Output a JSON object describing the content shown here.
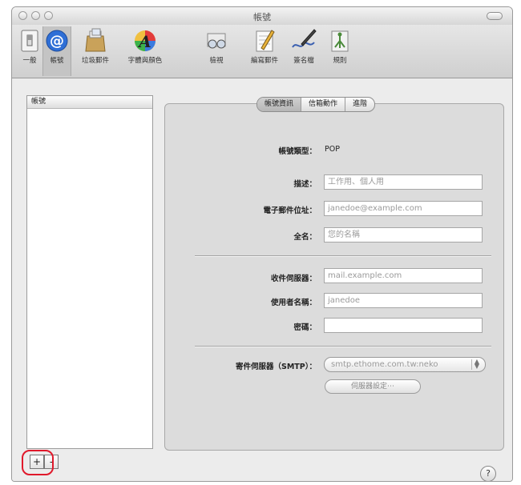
{
  "window": {
    "title": "帳號"
  },
  "toolbar": {
    "items": [
      {
        "label": "一般"
      },
      {
        "label": "帳號"
      },
      {
        "label": "垃圾郵件"
      },
      {
        "label": "字體與顏色"
      },
      {
        "label": "檢視"
      },
      {
        "label": "編寫郵件"
      },
      {
        "label": "簽名檔"
      },
      {
        "label": "規則"
      }
    ]
  },
  "account_list": {
    "header": "帳號"
  },
  "tabs": [
    {
      "label": "帳號資訊",
      "selected": true
    },
    {
      "label": "信箱動作",
      "selected": false
    },
    {
      "label": "進階",
      "selected": false
    }
  ],
  "form": {
    "account_type_label": "帳號類型：",
    "account_type_value": "POP",
    "description_label": "描述：",
    "description_placeholder": "工作用、個人用",
    "email_label": "電子郵件位址：",
    "email_placeholder": "janedoe@example.com",
    "fullname_label": "全名：",
    "fullname_placeholder": "您的名稱",
    "incoming_label": "收件伺服器：",
    "incoming_placeholder": "mail.example.com",
    "username_label": "使用者名稱：",
    "username_placeholder": "janedoe",
    "password_label": "密碼：",
    "password_value": "",
    "smtp_label": "寄件伺服器（SMTP）：",
    "smtp_value": "smtp.ethome.com.tw:neko",
    "server_settings_button": "伺服器設定⋯"
  },
  "bottom": {
    "add_label": "+",
    "remove_label": "-",
    "help_label": "?"
  },
  "colors": {
    "highlight": "#e0192b",
    "panel": "#dcdcdc",
    "window": "#ececec"
  }
}
